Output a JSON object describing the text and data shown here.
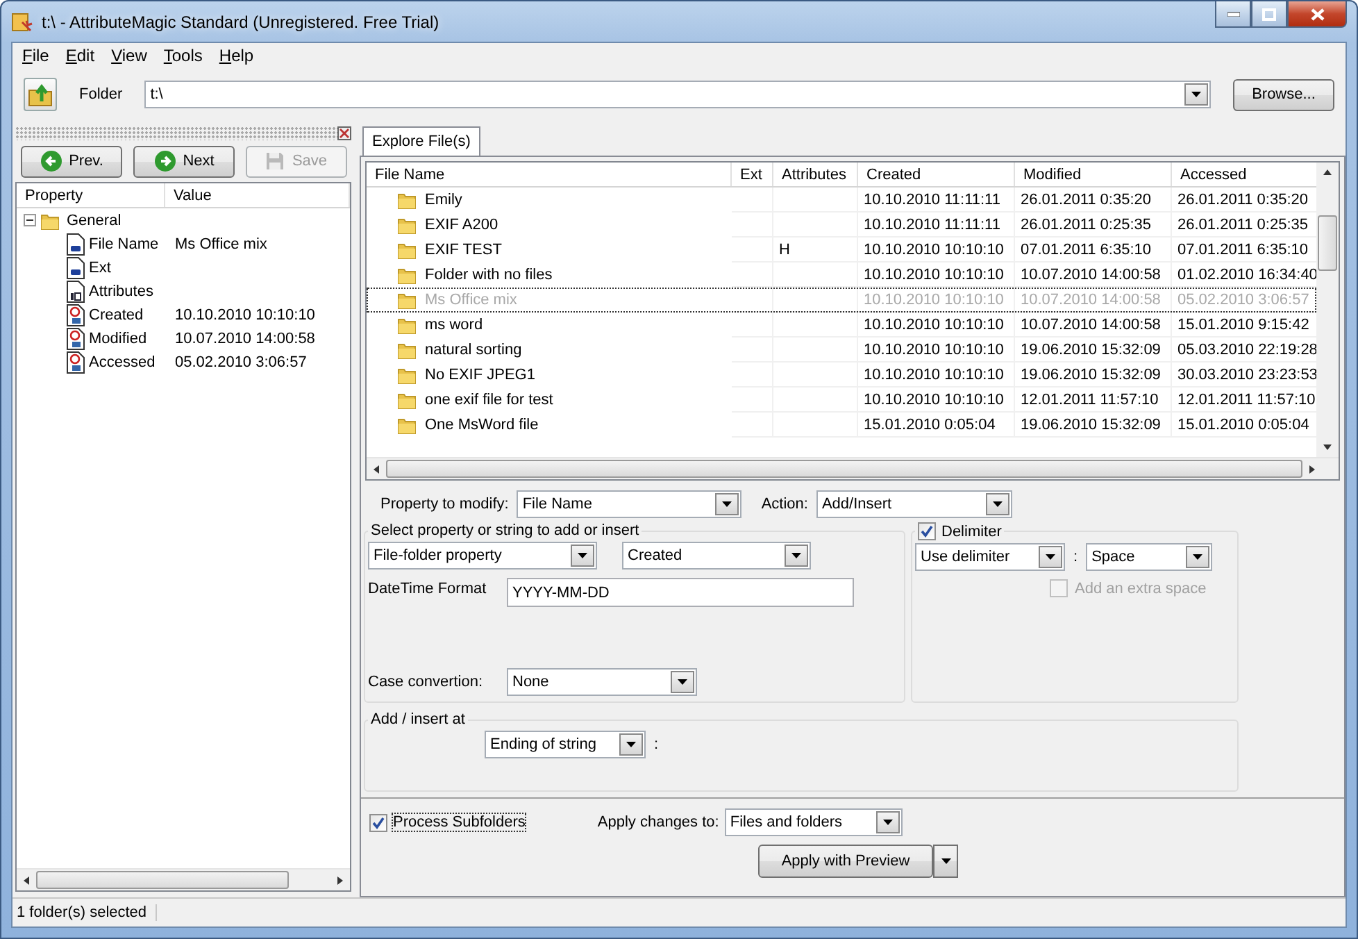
{
  "window": {
    "title": "t:\\ - AttributeMagic Standard (Unregistered. Free Trial)"
  },
  "menu": [
    "File",
    "Edit",
    "View",
    "Tools",
    "Help"
  ],
  "toolbar": {
    "folder_label": "Folder",
    "folder_value": "t:\\",
    "browse_button": "Browse..."
  },
  "left_panel": {
    "buttons": [
      {
        "label": "Prev.",
        "kind": "prev",
        "disabled": false
      },
      {
        "label": "Next",
        "kind": "next",
        "disabled": false
      },
      {
        "label": "Save",
        "kind": "save",
        "disabled": true
      }
    ],
    "columns": [
      "Property",
      "Value"
    ],
    "tree": {
      "label": "General",
      "expanded": true,
      "children": [
        {
          "label": "File Name",
          "value": "Ms Office mix",
          "kind": "text"
        },
        {
          "label": "Ext",
          "kind": "text"
        },
        {
          "label": "Attributes",
          "kind": "number"
        },
        {
          "label": "Created",
          "value": "10.10.2010 10:10:10",
          "kind": "date"
        },
        {
          "label": "Modified",
          "value": "10.07.2010 14:00:58",
          "kind": "date"
        },
        {
          "label": "Accessed",
          "value": "05.02.2010 3:06:57",
          "kind": "date"
        }
      ]
    }
  },
  "tabs": [
    {
      "label": "Explore File(s)",
      "selected": true
    }
  ],
  "file_list": {
    "columns": [
      "File Name",
      "Ext",
      "Attributes",
      "Created",
      "Modified",
      "Accessed"
    ],
    "rows": [
      {
        "name": "Emily",
        "created": "10.10.2010 11:11:11",
        "modified": "26.01.2011 0:35:20",
        "accessed": "26.01.2011 0:35:20",
        "selected": false
      },
      {
        "name": "EXIF A200",
        "created": "10.10.2010 11:11:11",
        "modified": "26.01.2011 0:25:35",
        "accessed": "26.01.2011 0:25:35",
        "selected": false
      },
      {
        "name": "EXIF TEST",
        "attributes": "H",
        "created": "10.10.2010 10:10:10",
        "modified": "07.01.2011 6:35:10",
        "accessed": "07.01.2011 6:35:10",
        "selected": false
      },
      {
        "name": "Folder with no files",
        "created": "10.10.2010 10:10:10",
        "modified": "10.07.2010 14:00:58",
        "accessed": "01.02.2010 16:34:40",
        "selected": false
      },
      {
        "name": "Ms Office mix",
        "created": "10.10.2010 10:10:10",
        "modified": "10.07.2010 14:00:58",
        "accessed": "05.02.2010 3:06:57",
        "selected": true
      },
      {
        "name": "ms word",
        "created": "10.10.2010 10:10:10",
        "modified": "10.07.2010 14:00:58",
        "accessed": "15.01.2010 9:15:42",
        "selected": false
      },
      {
        "name": "natural sorting",
        "created": "10.10.2010 10:10:10",
        "modified": "19.06.2010 15:32:09",
        "accessed": "05.03.2010 22:19:28",
        "selected": false
      },
      {
        "name": "No EXIF JPEG1",
        "created": "10.10.2010 10:10:10",
        "modified": "19.06.2010 15:32:09",
        "accessed": "30.03.2010 23:23:53",
        "selected": false
      },
      {
        "name": "one exif file for test",
        "created": "10.10.2010 10:10:10",
        "modified": "12.01.2011 11:57:10",
        "accessed": "12.01.2011 11:57:10",
        "selected": false
      },
      {
        "name": "One MsWord file",
        "created": "15.01.2010 0:05:04",
        "modified": "19.06.2010 15:32:09",
        "accessed": "15.01.2010 0:05:04",
        "selected": false
      }
    ]
  },
  "form": {
    "property_label": "Property to modify:",
    "property_value": "File Name",
    "action_label": "Action:",
    "action_value": "Add/Insert",
    "select_group": {
      "title": "Select property or string to add or insert",
      "source": "File-folder property",
      "property": "Created",
      "datetime_label": "DateTime Format",
      "datetime_value": "YYYY-MM-DD",
      "case_label": "Case convertion:",
      "case_value": "None"
    },
    "delimiter": {
      "label": "Delimiter",
      "checked": true,
      "mode": "Use delimiter",
      "separator": ":",
      "value": "Space",
      "extra_space": {
        "label": "Add an extra space",
        "checked": false,
        "disabled": true
      }
    },
    "insert_group": {
      "title": "Add / insert at",
      "position": "Ending of string",
      "separator": ":"
    },
    "process_subfolders": {
      "label": "Process Subfolders",
      "checked": true
    },
    "apply_to_label": "Apply changes to:",
    "apply_to_value": "Files and folders",
    "apply_button": "Apply with Preview"
  },
  "status_bar": "1 folder(s) selected"
}
